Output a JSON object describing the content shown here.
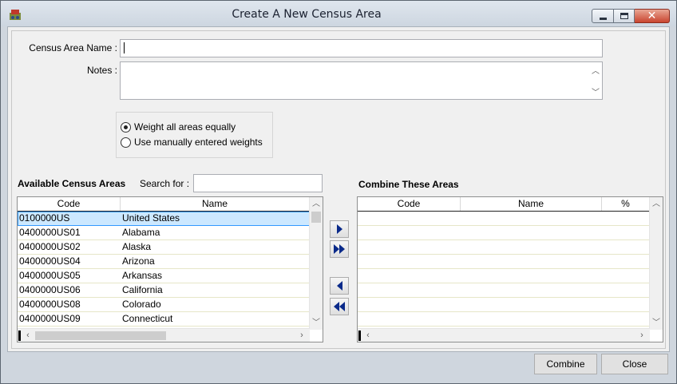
{
  "window": {
    "title": "Create A New Census Area"
  },
  "form": {
    "name_label": "Census Area Name :",
    "name_value": "",
    "notes_label": "Notes :",
    "notes_value": ""
  },
  "weighting": {
    "options": [
      {
        "label": "Weight all areas equally",
        "checked": true
      },
      {
        "label": "Use manually entered weights",
        "checked": false
      }
    ]
  },
  "available": {
    "title": "Available Census Areas",
    "search_label": "Search for :",
    "search_value": "",
    "columns": [
      "Code",
      "Name"
    ],
    "rows": [
      {
        "code": "0100000US",
        "name": "United States",
        "selected": true
      },
      {
        "code": "0400000US01",
        "name": "Alabama"
      },
      {
        "code": "0400000US02",
        "name": "Alaska"
      },
      {
        "code": "0400000US04",
        "name": "Arizona"
      },
      {
        "code": "0400000US05",
        "name": "Arkansas"
      },
      {
        "code": "0400000US06",
        "name": "California"
      },
      {
        "code": "0400000US08",
        "name": "Colorado"
      },
      {
        "code": "0400000US09",
        "name": "Connecticut"
      }
    ]
  },
  "combine": {
    "title": "Combine These Areas",
    "columns": [
      "Code",
      "Name",
      "%"
    ],
    "rows": []
  },
  "buttons": {
    "combine": "Combine",
    "close": "Close"
  },
  "colors": {
    "selection": "#cce8ff",
    "arrow": "#0a2a8a"
  }
}
